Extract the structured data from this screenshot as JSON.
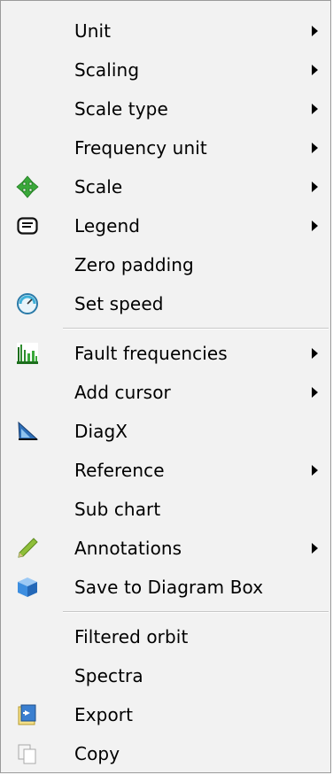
{
  "menu": {
    "items": [
      {
        "label": "Unit",
        "submenu": true,
        "icon": ""
      },
      {
        "label": "Scaling",
        "submenu": true,
        "icon": ""
      },
      {
        "label": "Scale type",
        "submenu": true,
        "icon": ""
      },
      {
        "label": "Frequency unit",
        "submenu": true,
        "icon": ""
      },
      {
        "label": "Scale",
        "submenu": true,
        "icon": "move-arrows-icon"
      },
      {
        "label": "Legend",
        "submenu": true,
        "icon": "legend-icon"
      },
      {
        "label": "Zero padding",
        "submenu": false,
        "icon": ""
      },
      {
        "label": "Set speed",
        "submenu": false,
        "icon": "speedometer-icon"
      },
      {
        "label": "Fault frequencies",
        "submenu": true,
        "icon": "fault-chart-icon"
      },
      {
        "label": "Add cursor",
        "submenu": true,
        "icon": ""
      },
      {
        "label": "DiagX",
        "submenu": false,
        "icon": "diagx-icon"
      },
      {
        "label": "Reference",
        "submenu": true,
        "icon": ""
      },
      {
        "label": "Sub chart",
        "submenu": false,
        "icon": ""
      },
      {
        "label": "Annotations",
        "submenu": true,
        "icon": "pencil-icon"
      },
      {
        "label": "Save to Diagram Box",
        "submenu": false,
        "icon": "cube-icon"
      },
      {
        "label": "Filtered orbit",
        "submenu": false,
        "icon": ""
      },
      {
        "label": "Spectra",
        "submenu": false,
        "icon": ""
      },
      {
        "label": "Export",
        "submenu": false,
        "icon": "export-icon"
      },
      {
        "label": "Copy",
        "submenu": false,
        "icon": "copy-icon"
      }
    ]
  }
}
